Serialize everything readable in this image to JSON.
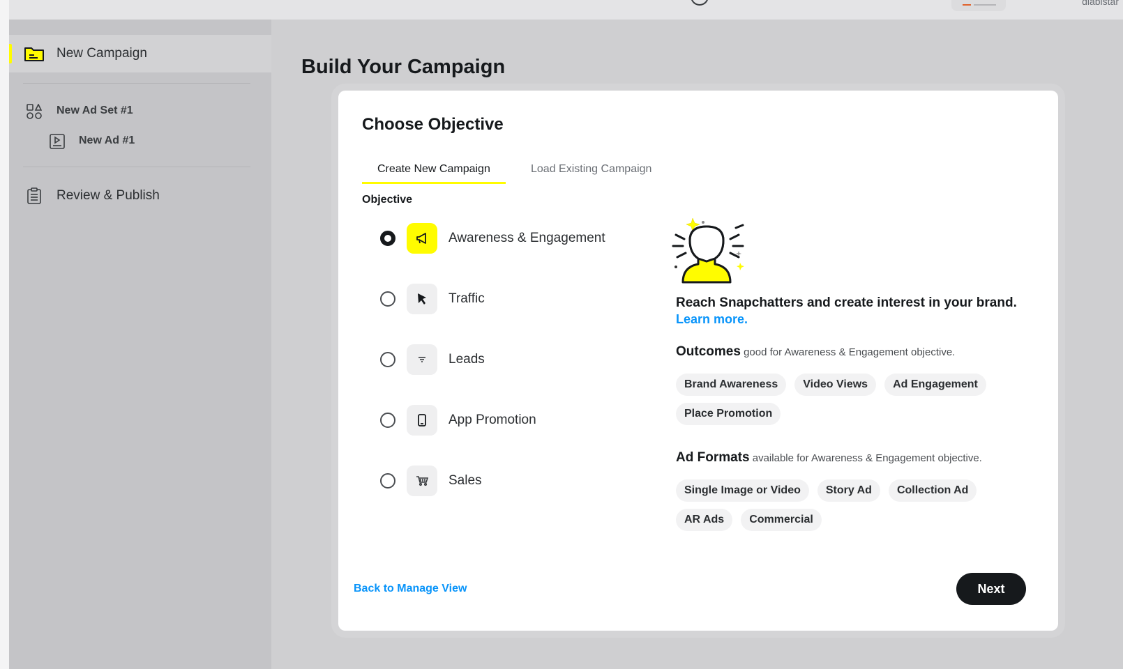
{
  "topbar": {
    "user": "diabistar"
  },
  "sidebar": {
    "new_campaign": "New Campaign",
    "ad_set": "New Ad Set #1",
    "ad": "New Ad #1",
    "review": "Review & Publish"
  },
  "page_title": "Build Your Campaign",
  "card": {
    "title": "Choose Objective",
    "tabs": [
      "Create New Campaign",
      "Load Existing Campaign"
    ],
    "objective_label": "Objective",
    "objectives": [
      {
        "label": "Awareness & Engagement",
        "icon": "megaphone-icon",
        "selected": true
      },
      {
        "label": "Traffic",
        "icon": "cursor-icon",
        "selected": false
      },
      {
        "label": "Leads",
        "icon": "filter-icon",
        "selected": false
      },
      {
        "label": "App Promotion",
        "icon": "phone-icon",
        "selected": false
      },
      {
        "label": "Sales",
        "icon": "cart-icon",
        "selected": false
      }
    ],
    "description": "Reach Snapchatters and create interest in your brand.",
    "learn_more": "Learn more.",
    "outcomes_title": "Outcomes",
    "outcomes_sub": "good for Awareness & Engagement objective.",
    "outcomes": [
      "Brand Awareness",
      "Video Views",
      "Ad Engagement",
      "Place Promotion"
    ],
    "formats_title": "Ad Formats",
    "formats_sub": "available for Awareness & Engagement objective.",
    "formats": [
      "Single Image or Video",
      "Story Ad",
      "Collection Ad",
      "AR Ads",
      "Commercial"
    ],
    "back_link": "Back to Manage View",
    "next": "Next"
  },
  "colors": {
    "accent": "#fffc00",
    "link": "#0894fa",
    "dark": "#16191c"
  }
}
